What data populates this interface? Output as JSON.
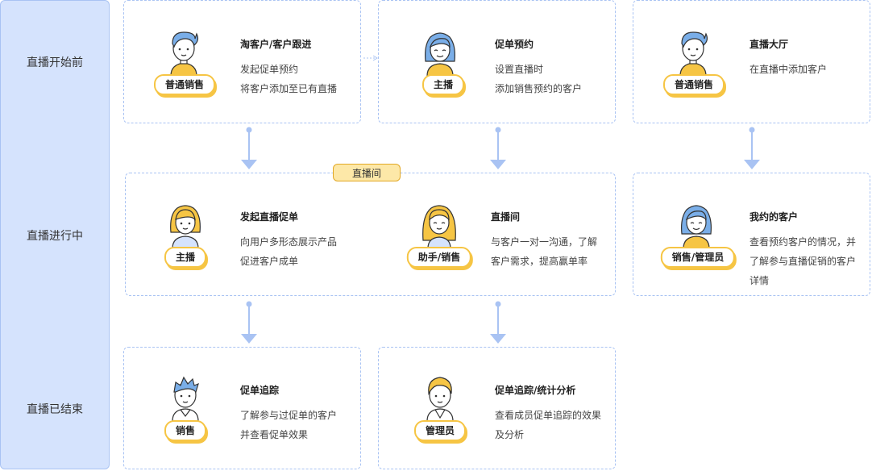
{
  "phases": [
    "直播开始前",
    "直播进行中",
    "直播已结束"
  ],
  "hall_tag": "直播间",
  "cards": {
    "c1": {
      "role": "普通销售",
      "title": "淘客户/客户跟进",
      "lines": [
        "发起促单预约",
        "将客户添加至已有直播"
      ]
    },
    "c2": {
      "role": "主播",
      "title": "促单预约",
      "lines": [
        "设置直播时",
        "添加销售预约的客户"
      ]
    },
    "c3": {
      "role": "普通销售",
      "title": "直播大厅",
      "lines": [
        "在直播中添加客户"
      ]
    },
    "c4": {
      "role": "主播",
      "title": "发起直播促单",
      "lines": [
        "向用户多形态展示产品",
        "促进客户成单"
      ]
    },
    "c5": {
      "role": "助手/销售",
      "title": "直播间",
      "lines": [
        "与客户一对一沟通，了解",
        "客户需求，提高赢单率"
      ]
    },
    "c6": {
      "role": "销售/管理员",
      "title": "我约的客户",
      "lines": [
        "查看预约客户的情况，并了解参与直播促销的客户详情"
      ]
    },
    "c7": {
      "role": "销售",
      "title": "促单追踪",
      "lines": [
        "了解参与过促单的客户",
        "并查看促单效果"
      ]
    },
    "c8": {
      "role": "管理员",
      "title": "促单追踪/统计分析",
      "lines": [
        "查看成员促单追踪的效果",
        "及分析"
      ]
    }
  },
  "colors": {
    "blue": "#a9c3f3",
    "arrow": "#a9c3f3",
    "yellow": "#f6c544",
    "skin": "#ffffff",
    "hair_blue": "#7aaee8",
    "hair_yellow": "#f6c544"
  }
}
